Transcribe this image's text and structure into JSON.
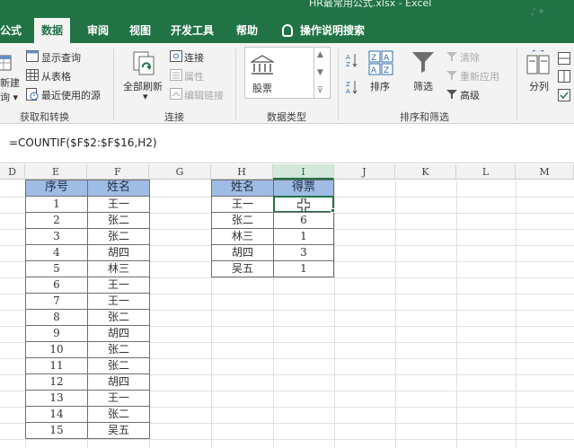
{
  "window": {
    "title": "HR最常用公式.xlsx  -  Excel"
  },
  "ribbon_tabs": [
    "公式",
    "数据",
    "审阅",
    "视图",
    "开发工具",
    "帮助",
    "操作说明搜索"
  ],
  "active_tab": "数据",
  "ribbon": {
    "get_transform": {
      "new_query": "新建",
      "new_query_sub": "询 ▾",
      "show_queries": "显示查询",
      "from_table": "从表格",
      "recent_sources": "最近使用的源",
      "group_label": "获取和转换"
    },
    "connections": {
      "refresh_all": "全部刷新",
      "refresh_caret": "▾",
      "connections": "连接",
      "properties": "属性",
      "edit_links": "编辑链接",
      "group_label": "连接"
    },
    "data_types": {
      "stocks": "股票",
      "group_label": "数据类型"
    },
    "sort_filter": {
      "sort": "排序",
      "filter": "筛选",
      "clear": "清除",
      "reapply": "重新应用",
      "advanced": "高级",
      "group_label": "排序和筛选"
    },
    "data_tools": {
      "split": "分列"
    }
  },
  "formula_bar": {
    "formula": "=COUNTIF($F$2:$F$16,H2)"
  },
  "columns": [
    "D",
    "E",
    "F",
    "G",
    "H",
    "I",
    "J",
    "K",
    "L",
    "M"
  ],
  "selected_column": "I",
  "table1": {
    "headers": [
      "序号",
      "姓名"
    ],
    "rows": [
      [
        "1",
        "王一"
      ],
      [
        "2",
        "张二"
      ],
      [
        "3",
        "张二"
      ],
      [
        "4",
        "胡四"
      ],
      [
        "5",
        "林三"
      ],
      [
        "6",
        "王一"
      ],
      [
        "7",
        "王一"
      ],
      [
        "8",
        "张二"
      ],
      [
        "9",
        "胡四"
      ],
      [
        "10",
        "张二"
      ],
      [
        "11",
        "张二"
      ],
      [
        "12",
        "胡四"
      ],
      [
        "13",
        "王一"
      ],
      [
        "14",
        "张二"
      ],
      [
        "15",
        "吴五"
      ]
    ]
  },
  "table2": {
    "headers": [
      "姓名",
      "得票"
    ],
    "rows": [
      [
        "王一",
        ""
      ],
      [
        "张二",
        "6"
      ],
      [
        "林三",
        "1"
      ],
      [
        "胡四",
        "3"
      ],
      [
        "吴五",
        "1"
      ]
    ]
  },
  "colors": {
    "excel_green": "#217346",
    "header_fill": "#9fbce4"
  }
}
